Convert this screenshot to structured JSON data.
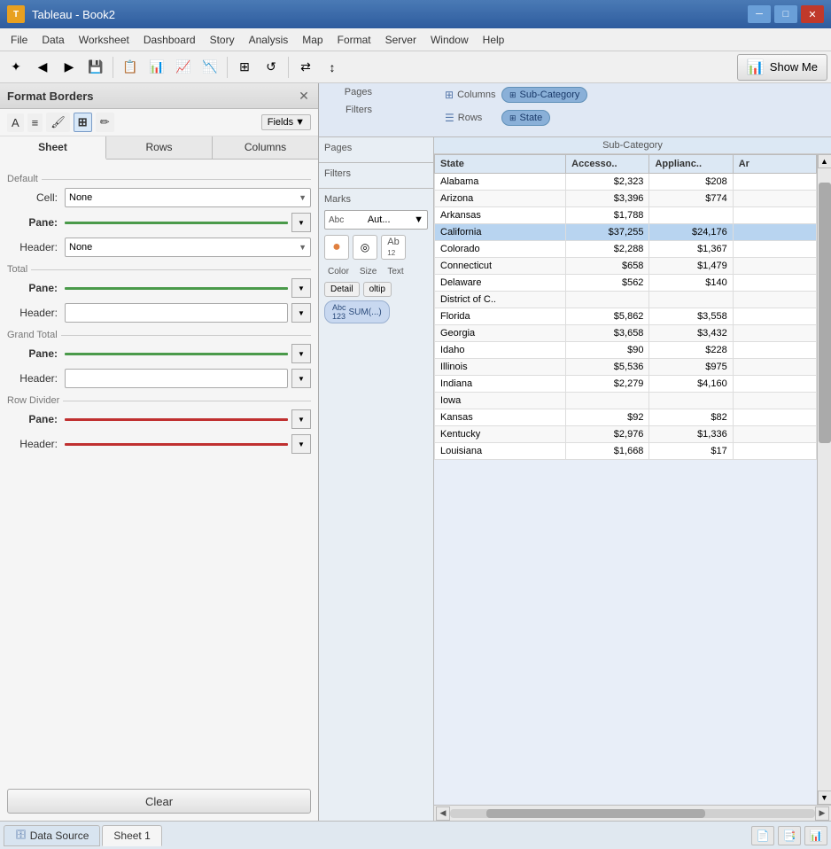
{
  "titleBar": {
    "icon": "T",
    "title": "Tableau - Book2",
    "minLabel": "─",
    "maxLabel": "□",
    "closeLabel": "✕"
  },
  "menuBar": {
    "items": [
      "File",
      "Data",
      "Worksheet",
      "Dashboard",
      "Story",
      "Analysis",
      "Map",
      "Format",
      "Server",
      "Window",
      "Help"
    ]
  },
  "toolbar": {
    "showMeLabel": "Show Me"
  },
  "formatPanel": {
    "title": "Format Borders",
    "fieldsLabel": "Fields",
    "tabs": [
      "Sheet",
      "Rows",
      "Columns"
    ],
    "activeTab": "Sheet",
    "sections": {
      "default": {
        "label": "Default",
        "cell": {
          "label": "Cell:",
          "value": "None"
        },
        "pane": {
          "label": "Pane:"
        },
        "header": {
          "label": "Header:",
          "value": "None"
        }
      },
      "total": {
        "label": "Total",
        "pane": {
          "label": "Pane:"
        },
        "header": {
          "label": "Header:"
        }
      },
      "grandTotal": {
        "label": "Grand Total",
        "pane": {
          "label": "Pane:"
        },
        "header": {
          "label": "Header:"
        }
      },
      "rowDivider": {
        "label": "Row Divider",
        "pane": {
          "label": "Pane:"
        },
        "header": {
          "label": "Header:"
        }
      }
    },
    "clearLabel": "Clear"
  },
  "pages": {
    "label": "Pages"
  },
  "filters": {
    "label": "Filters"
  },
  "marks": {
    "label": "Marks",
    "typeLabel": "Aut...",
    "colorLabel": "Color",
    "sizeLabel": "Size",
    "textLabel": "Text",
    "detailLabel": "Detail",
    "tooltipLabel": "oltip",
    "sumLabel": "SUM(...)"
  },
  "columns": {
    "label": "Columns",
    "pill": "Sub-Category"
  },
  "rows": {
    "label": "Rows",
    "pill": "State"
  },
  "subCategoryHeader": "Sub-Category",
  "tableHeaders": [
    "State",
    "Accesso..",
    "Applianc..",
    "Ar"
  ],
  "tableData": [
    {
      "state": "Alabama",
      "acc": "$2,323",
      "app": "$208",
      "ar": "",
      "highlight": false
    },
    {
      "state": "Arizona",
      "acc": "$3,396",
      "app": "$774",
      "ar": "",
      "highlight": false
    },
    {
      "state": "Arkansas",
      "acc": "$1,788",
      "app": "",
      "ar": "",
      "highlight": false
    },
    {
      "state": "California",
      "acc": "$37,255",
      "app": "$24,176",
      "ar": "",
      "highlight": true
    },
    {
      "state": "Colorado",
      "acc": "$2,288",
      "app": "$1,367",
      "ar": "",
      "highlight": false
    },
    {
      "state": "Connecticut",
      "acc": "$658",
      "app": "$1,479",
      "ar": "",
      "highlight": false
    },
    {
      "state": "Delaware",
      "acc": "$562",
      "app": "$140",
      "ar": "",
      "highlight": false
    },
    {
      "state": "District of C..",
      "acc": "",
      "app": "",
      "ar": "",
      "highlight": false
    },
    {
      "state": "Florida",
      "acc": "$5,862",
      "app": "$3,558",
      "ar": "",
      "highlight": false
    },
    {
      "state": "Georgia",
      "acc": "$3,658",
      "app": "$3,432",
      "ar": "",
      "highlight": false
    },
    {
      "state": "Idaho",
      "acc": "$90",
      "app": "$228",
      "ar": "",
      "highlight": false
    },
    {
      "state": "Illinois",
      "acc": "$5,536",
      "app": "$975",
      "ar": "",
      "highlight": false
    },
    {
      "state": "Indiana",
      "acc": "$2,279",
      "app": "$4,160",
      "ar": "",
      "highlight": false
    },
    {
      "state": "Iowa",
      "acc": "",
      "app": "",
      "ar": "",
      "highlight": false
    },
    {
      "state": "Kansas",
      "acc": "$92",
      "app": "$82",
      "ar": "",
      "highlight": false
    },
    {
      "state": "Kentucky",
      "acc": "$2,976",
      "app": "$1,336",
      "ar": "",
      "highlight": false
    },
    {
      "state": "Louisiana",
      "acc": "$1,668",
      "app": "$17",
      "ar": "",
      "highlight": false
    }
  ],
  "statusBar": {
    "dataSourceLabel": "Data Source",
    "sheet1Label": "Sheet 1"
  }
}
